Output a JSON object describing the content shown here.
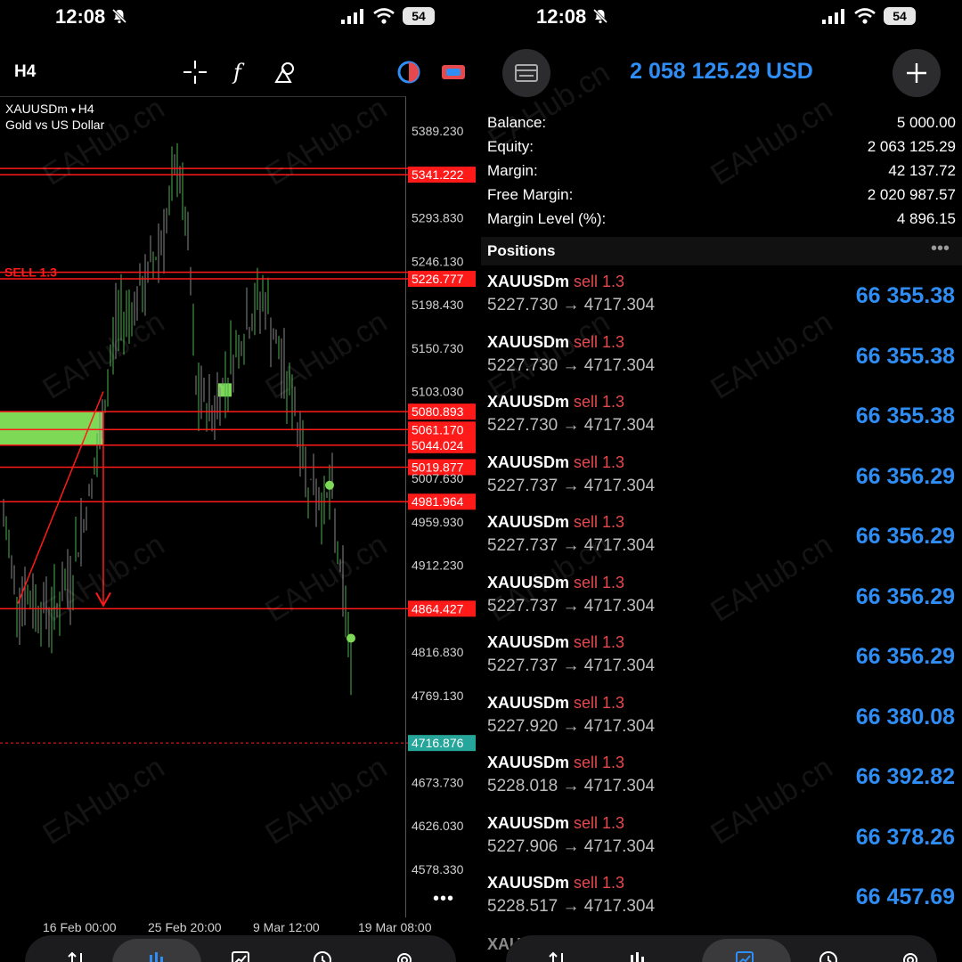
{
  "left": {
    "status": {
      "time": "12:08",
      "battery": "54"
    },
    "timeframe": "H4",
    "symbol": "XAUUSDm",
    "symbol_tf": "H4",
    "symbol_desc": "Gold vs US Dollar",
    "sell_label": "SELL 1.3",
    "price_axis": [
      "5389.230",
      "5293.830",
      "5246.130",
      "5198.430",
      "5150.730",
      "5103.030",
      "5007.630",
      "4959.930",
      "4912.230",
      "4816.830",
      "4769.130",
      "4673.730",
      "4626.030",
      "4578.330"
    ],
    "red_levels": [
      "5341.222",
      "5226.777",
      "5080.893",
      "5061.170",
      "5044.024",
      "5019.877",
      "4981.964",
      "4864.427"
    ],
    "current_price": "4716.876",
    "time_axis": [
      "16 Feb 00:00",
      "25 Feb 20:00",
      "9 Mar 12:00",
      "19 Mar 08:00"
    ],
    "colors": {
      "level": "#ff1a1a",
      "current": "#26a69a",
      "zone": "#7ed957"
    }
  },
  "right": {
    "status": {
      "time": "12:08",
      "battery": "54"
    },
    "header": {
      "title": "2 058 125.29 USD"
    },
    "account": [
      {
        "label": "Balance:",
        "value": "5 000.00"
      },
      {
        "label": "Equity:",
        "value": "2 063 125.29"
      },
      {
        "label": "Margin:",
        "value": "42 137.72"
      },
      {
        "label": "Free Margin:",
        "value": "2 020 987.57"
      },
      {
        "label": "Margin Level (%):",
        "value": "4 896.15"
      }
    ],
    "positions_title": "Positions",
    "positions": [
      {
        "symbol": "XAUUSDm",
        "side": "sell 1.3",
        "prices": "5227.730 → 4717.304",
        "profit": "66 355.38"
      },
      {
        "symbol": "XAUUSDm",
        "side": "sell 1.3",
        "prices": "5227.730 → 4717.304",
        "profit": "66 355.38"
      },
      {
        "symbol": "XAUUSDm",
        "side": "sell 1.3",
        "prices": "5227.730 → 4717.304",
        "profit": "66 355.38"
      },
      {
        "symbol": "XAUUSDm",
        "side": "sell 1.3",
        "prices": "5227.737 → 4717.304",
        "profit": "66 356.29"
      },
      {
        "symbol": "XAUUSDm",
        "side": "sell 1.3",
        "prices": "5227.737 → 4717.304",
        "profit": "66 356.29"
      },
      {
        "symbol": "XAUUSDm",
        "side": "sell 1.3",
        "prices": "5227.737 → 4717.304",
        "profit": "66 356.29"
      },
      {
        "symbol": "XAUUSDm",
        "side": "sell 1.3",
        "prices": "5227.737 → 4717.304",
        "profit": "66 356.29"
      },
      {
        "symbol": "XAUUSDm",
        "side": "sell 1.3",
        "prices": "5227.920 → 4717.304",
        "profit": "66 380.08"
      },
      {
        "symbol": "XAUUSDm",
        "side": "sell 1.3",
        "prices": "5228.018 → 4717.304",
        "profit": "66 392.82"
      },
      {
        "symbol": "XAUUSDm",
        "side": "sell 1.3",
        "prices": "5227.906 → 4717.304",
        "profit": "66 378.26"
      },
      {
        "symbol": "XAUUSDm",
        "side": "sell 1.3",
        "prices": "5228.517 → 4717.304",
        "profit": "66 457.69"
      }
    ],
    "partial_row": "XAU",
    "colors": {
      "accent": "#2e8ef5",
      "sell": "#e5484d"
    }
  },
  "watermark": "EAHub.cn"
}
